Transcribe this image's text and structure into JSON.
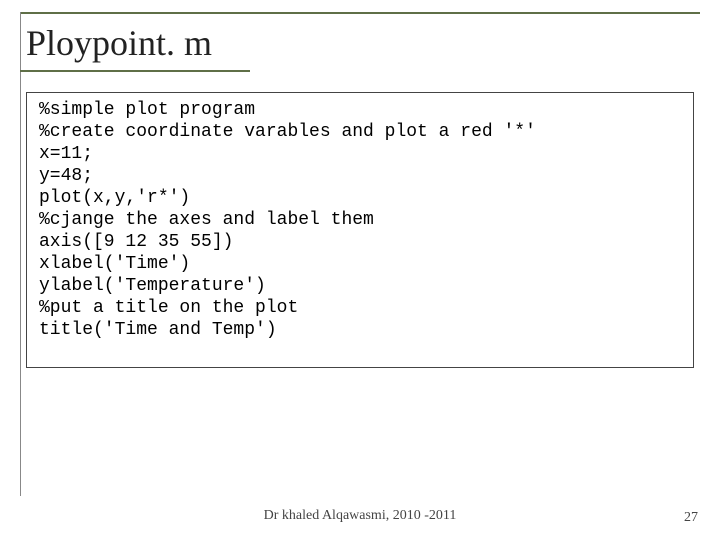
{
  "title": "Ploypoint. m",
  "code_lines": [
    "%simple plot program",
    "%create coordinate varables and plot a red '*'",
    "x=11;",
    "y=48;",
    "plot(x,y,'r*')",
    "%cjange the axes and label them",
    "axis([9 12 35 55])",
    "xlabel('Time')",
    "ylabel('Temperature')",
    "%put a title on the plot",
    "title('Time and Temp')"
  ],
  "footer": "Dr khaled Alqawasmi, 2010 -2011",
  "page_number": "27"
}
